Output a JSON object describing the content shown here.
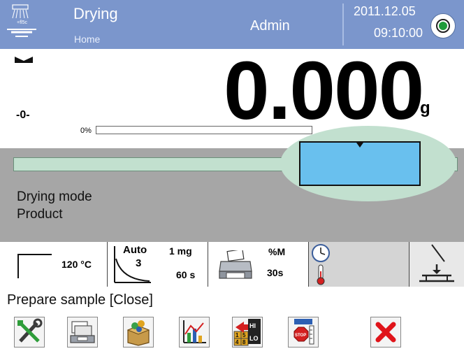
{
  "header": {
    "app_title": "Drying",
    "subtitle": "Home",
    "user": "Admin",
    "date": "2011.12.05",
    "time": "09:10:00",
    "logo_icon": "drying-lamp-icon",
    "status_icon": "record-status-icon"
  },
  "weight": {
    "value": "0.000",
    "unit": "g",
    "zero_indicator": "-0-",
    "stable_icon": "stability-marker-icon",
    "bar_label": "0%",
    "bar_fill": 0
  },
  "process": {
    "mode_label": "Drying mode",
    "mode_value": "Product"
  },
  "info_row": {
    "temperature": "120 °C",
    "auto_label": "Auto",
    "auto_number": "3",
    "resolution": "1 mg",
    "time": "60 s",
    "result_unit": "%M",
    "result_interval": "30s",
    "icons": {
      "profile": "standard-profile-icon",
      "curve": "auto-finish-curve-icon",
      "printer": "printer-icon",
      "clock": "clock-icon",
      "thermometer": "thermometer-icon",
      "pan": "weighing-pan-icon"
    }
  },
  "status_message": "Prepare sample [Close]",
  "toolbar": {
    "buttons": [
      {
        "name": "settings-button",
        "icon": "tools-icon"
      },
      {
        "name": "database-button",
        "icon": "database-icon"
      },
      {
        "name": "product-button",
        "icon": "product-box-icon"
      },
      {
        "name": "graph-button",
        "icon": "chart-icon"
      },
      {
        "name": "checkweighing-button",
        "icon": "checkweighing-hi-lo-icon"
      },
      {
        "name": "stop-button",
        "icon": "stop-sign-icon"
      },
      {
        "name": "close-button",
        "icon": "close-icon"
      }
    ],
    "checkweigh_hi": "HI",
    "checkweigh_lo": "LO",
    "keypad_digits": [
      "1",
      "5",
      "4",
      "8"
    ],
    "stop_text": "STOP"
  },
  "colors": {
    "header_bg": "#7b96cc",
    "gray_bg": "#a6a6a6",
    "track_green": "#c2e0cf",
    "window_blue": "#69c0ee",
    "close_red": "#e0141a"
  }
}
